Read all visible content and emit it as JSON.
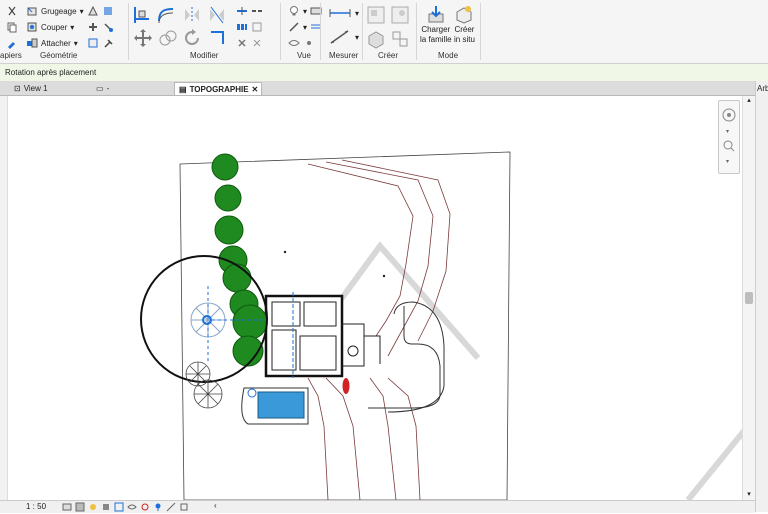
{
  "ribbon": {
    "tools": {
      "grugeage": "Grugeage",
      "couper": "Couper",
      "attacher": "Attacher",
      "charger_famille_line1": "Charger",
      "charger_famille_line2": "la famille",
      "creer_in_situ_line1": "Créer",
      "creer_in_situ_line2": "in situ"
    },
    "groups": {
      "presse_papiers": "apiers",
      "geometrie": "Géométrie",
      "modifier": "Modifier",
      "vue": "Vue",
      "mesurer": "Mesurer",
      "creer": "Créer",
      "mode": "Mode"
    }
  },
  "options_bar": {
    "rotation_label": "Rotation après placement"
  },
  "tabs": [
    {
      "label": "View 1"
    },
    {
      "label": "-"
    },
    {
      "label": "TOPOGRAPHIE"
    }
  ],
  "right_panel": {
    "label": "Arb"
  },
  "status": {
    "scale": "1 : 50"
  },
  "colors": {
    "accent": "#1e6fd9",
    "option_bar_bg": "#f0f7e6",
    "tree_green": "#1f8a1f",
    "contour": "#7a3b3b",
    "pool": "#3a9ad9",
    "car": "#d22222"
  }
}
